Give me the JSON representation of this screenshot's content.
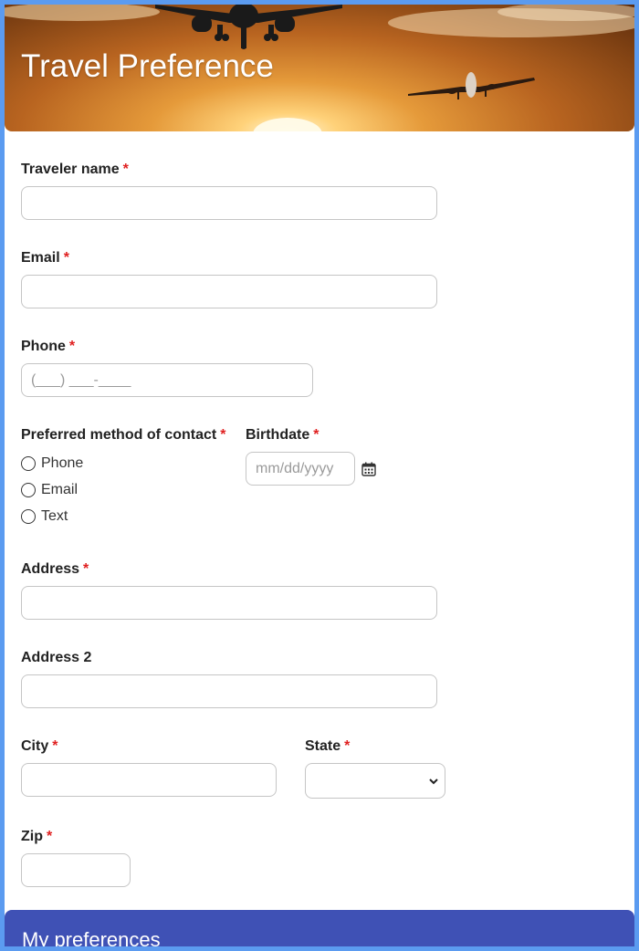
{
  "header": {
    "title": "Travel Preference"
  },
  "required_marker": "*",
  "fields": {
    "traveler_name": {
      "label": "Traveler name"
    },
    "email": {
      "label": "Email"
    },
    "phone": {
      "label": "Phone",
      "placeholder": "(___) ___-____"
    },
    "contact": {
      "label": "Preferred method of contact",
      "options": [
        "Phone",
        "Email",
        "Text"
      ]
    },
    "birthdate": {
      "label": "Birthdate",
      "placeholder": "mm/dd/yyyy"
    },
    "address": {
      "label": "Address"
    },
    "address2": {
      "label": "Address 2"
    },
    "city": {
      "label": "City"
    },
    "state": {
      "label": "State"
    },
    "zip": {
      "label": "Zip"
    }
  },
  "section": {
    "title": "My preferences"
  },
  "colors": {
    "accent": "#3f51b5",
    "frame": "#5b9bf0",
    "required": "#e02020"
  }
}
